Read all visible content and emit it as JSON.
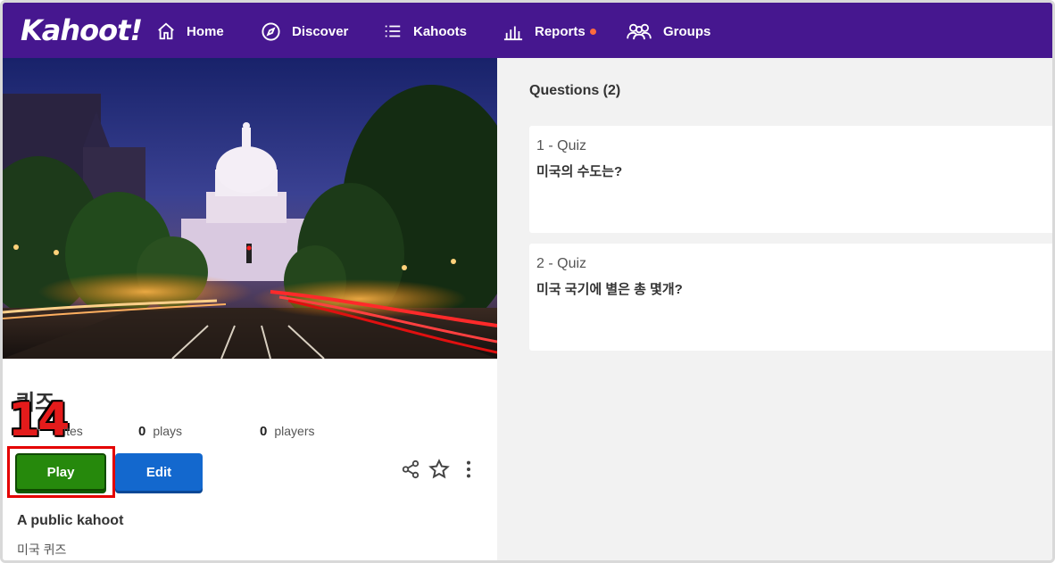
{
  "brand": {
    "logo_text": "Kahoot!"
  },
  "nav": {
    "items": [
      {
        "label": "Home",
        "icon": "home-icon"
      },
      {
        "label": "Discover",
        "icon": "compass-icon"
      },
      {
        "label": "Kahoots",
        "icon": "list-icon"
      },
      {
        "label": "Reports",
        "icon": "reports-icon",
        "has_notification": true
      },
      {
        "label": "Groups",
        "icon": "groups-icon"
      }
    ]
  },
  "kahoot": {
    "title": "퀴즈",
    "annotation_number": "14",
    "favorites_suffix": "ites",
    "plays_count": "0",
    "plays_label": "plays",
    "players_count": "0",
    "players_label": "players",
    "play_label": "Play",
    "edit_label": "Edit",
    "visibility": "A public kahoot",
    "description": "미국 퀴즈"
  },
  "questions": {
    "header": "Questions (2)",
    "items": [
      {
        "type": "1 - Quiz",
        "text": "미국의 수도는?"
      },
      {
        "type": "2 - Quiz",
        "text": "미국 국기에 별은 총 몇개?"
      }
    ]
  },
  "colors": {
    "nav_bg": "#46178f",
    "play_green": "#26890c",
    "edit_blue": "#1368ce",
    "highlight_red": "#e40000",
    "notification_dot": "#ff6b3d"
  }
}
